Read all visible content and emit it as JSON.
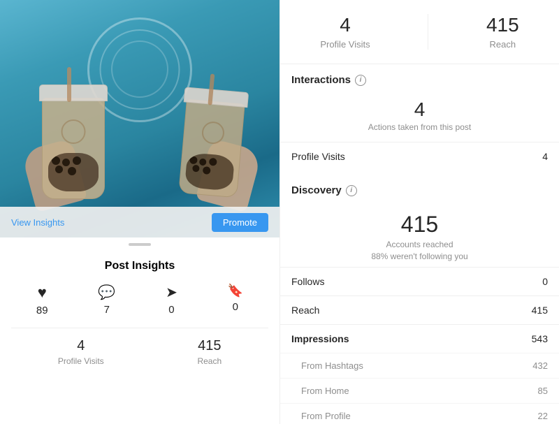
{
  "left": {
    "image_alt": "Two hands holding boba tea cups",
    "actions": {
      "view_insights": "View Insights",
      "promote": "Promote"
    },
    "post_insights_title": "Post Insights",
    "stats": [
      {
        "icon": "♥",
        "icon_name": "heart-icon",
        "value": "89"
      },
      {
        "icon": "●",
        "icon_name": "comment-icon",
        "value": "7"
      },
      {
        "icon": "▷",
        "icon_name": "share-icon",
        "value": "0"
      },
      {
        "icon": "🔖",
        "icon_name": "save-icon",
        "value": "0"
      }
    ],
    "bottom_stats": [
      {
        "number": "4",
        "label": "Profile Visits"
      },
      {
        "number": "415",
        "label": "Reach"
      }
    ]
  },
  "right": {
    "top_metrics": [
      {
        "number": "4",
        "label": "Profile Visits"
      },
      {
        "number": "415",
        "label": "Reach"
      }
    ],
    "interactions": {
      "title": "Interactions",
      "center_number": "4",
      "center_label": "Actions taken from this post",
      "rows": [
        {
          "label": "Profile Visits",
          "value": "4"
        }
      ]
    },
    "discovery": {
      "title": "Discovery",
      "center_number": "415",
      "center_label": "Accounts reached\n88% weren't following you",
      "rows": [
        {
          "label": "Follows",
          "value": "0",
          "bold": false
        },
        {
          "label": "Reach",
          "value": "415",
          "bold": false
        },
        {
          "label": "Impressions",
          "value": "543",
          "bold": true
        },
        {
          "label": "From Hashtags",
          "value": "432",
          "bold": false,
          "indented": true
        },
        {
          "label": "From Home",
          "value": "85",
          "bold": false,
          "indented": true
        },
        {
          "label": "From Profile",
          "value": "22",
          "bold": false,
          "indented": true
        }
      ]
    }
  }
}
